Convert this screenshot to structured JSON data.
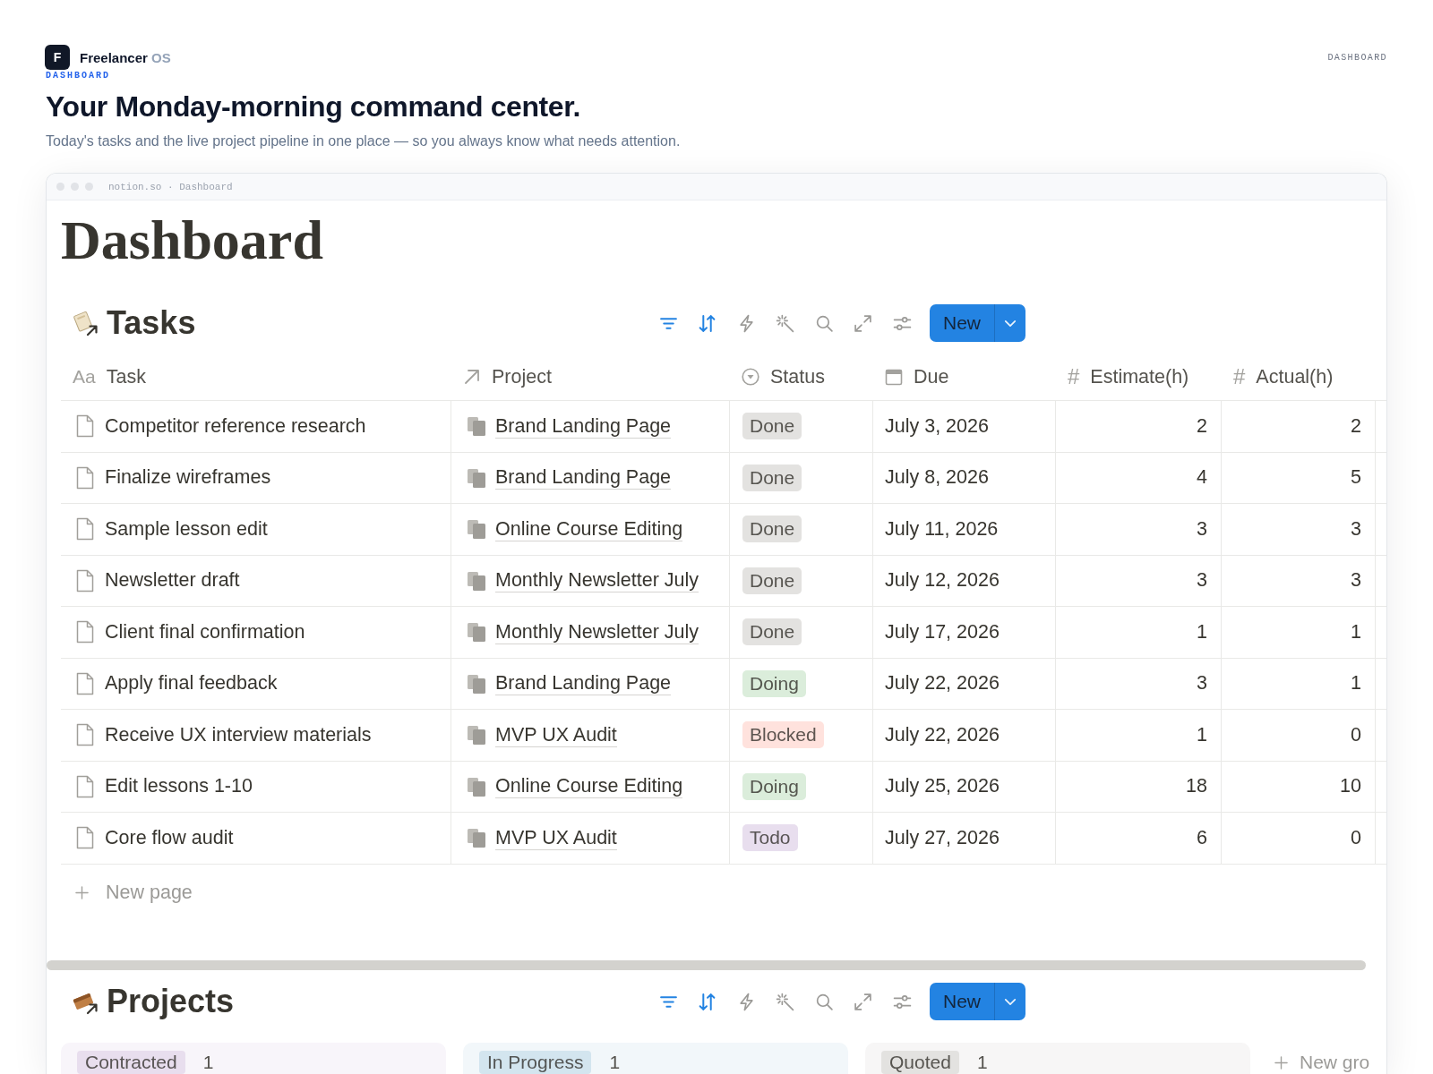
{
  "brand": {
    "logo_letter": "F",
    "name": "Freelancer",
    "suffix": "OS",
    "section": "DASHBOARD"
  },
  "nav_label": "DASHBOARD",
  "headline": "Your Monday-morning command center.",
  "subtitle": "Today's tasks and the live project pipeline in one place — so you always know what needs attention.",
  "browser": {
    "url": "notion.so · Dashboard"
  },
  "page_title": "Dashboard",
  "tasks": {
    "title": "Tasks",
    "tools": [
      {
        "kind": "filter",
        "active": true
      },
      {
        "kind": "sort",
        "active": true
      },
      {
        "kind": "automation",
        "active": false
      },
      {
        "kind": "ai",
        "active": false
      },
      {
        "kind": "search",
        "active": false
      },
      {
        "kind": "expand",
        "active": false
      },
      {
        "kind": "settings",
        "active": false
      }
    ],
    "new_button": "New",
    "columns": [
      {
        "kind": "title",
        "glyph": "Aa",
        "label": "Task"
      },
      {
        "kind": "relation",
        "label": "Project"
      },
      {
        "kind": "status",
        "label": "Status"
      },
      {
        "kind": "date",
        "label": "Due"
      },
      {
        "kind": "number",
        "glyph": "#",
        "label": "Estimate(h)"
      },
      {
        "kind": "number",
        "glyph": "#",
        "label": "Actual(h)"
      }
    ],
    "rows": [
      {
        "task": "Competitor reference research",
        "project": "Brand Landing Page",
        "status": {
          "label": "Done",
          "color": "#e3e2e0"
        },
        "due": "July 3, 2026",
        "estimate": "2",
        "actual": "2"
      },
      {
        "task": "Finalize wireframes",
        "project": "Brand Landing Page",
        "status": {
          "label": "Done",
          "color": "#e3e2e0"
        },
        "due": "July 8, 2026",
        "estimate": "4",
        "actual": "5"
      },
      {
        "task": "Sample lesson edit",
        "project": "Online Course Editing",
        "status": {
          "label": "Done",
          "color": "#e3e2e0"
        },
        "due": "July 11, 2026",
        "estimate": "3",
        "actual": "3"
      },
      {
        "task": "Newsletter draft",
        "project": "Monthly Newsletter July",
        "status": {
          "label": "Done",
          "color": "#e3e2e0"
        },
        "due": "July 12, 2026",
        "estimate": "3",
        "actual": "3"
      },
      {
        "task": "Client final confirmation",
        "project": "Monthly Newsletter July",
        "status": {
          "label": "Done",
          "color": "#e3e2e0"
        },
        "due": "July 17, 2026",
        "estimate": "1",
        "actual": "1"
      },
      {
        "task": "Apply final feedback",
        "project": "Brand Landing Page",
        "status": {
          "label": "Doing",
          "color": "#dbeddb"
        },
        "due": "July 22, 2026",
        "estimate": "3",
        "actual": "1"
      },
      {
        "task": "Receive UX interview materials",
        "project": "MVP UX Audit",
        "status": {
          "label": "Blocked",
          "color": "#ffe2dd"
        },
        "due": "July 22, 2026",
        "estimate": "1",
        "actual": "0"
      },
      {
        "task": "Edit lessons 1-10",
        "project": "Online Course Editing",
        "status": {
          "label": "Doing",
          "color": "#dbeddb"
        },
        "due": "July 25, 2026",
        "estimate": "18",
        "actual": "10"
      },
      {
        "task": "Core flow audit",
        "project": "MVP UX Audit",
        "status": {
          "label": "Todo",
          "color": "#e8deee"
        },
        "due": "July 27, 2026",
        "estimate": "6",
        "actual": "0"
      }
    ],
    "new_row": "New page"
  },
  "projects": {
    "title": "Projects",
    "tools": [
      {
        "kind": "filter",
        "active": true
      },
      {
        "kind": "sort",
        "active": true
      },
      {
        "kind": "automation",
        "active": false
      },
      {
        "kind": "ai",
        "active": false
      },
      {
        "kind": "search",
        "active": false
      },
      {
        "kind": "expand",
        "active": false
      },
      {
        "kind": "settings",
        "active": false
      }
    ],
    "new_button": "New",
    "groups": [
      {
        "label": "Contracted",
        "count": "1",
        "color": "#e8deee"
      },
      {
        "label": "In Progress",
        "count": "1",
        "color": "#d3e5ef"
      },
      {
        "label": "Quoted",
        "count": "1",
        "color": "#e3e2e0"
      }
    ],
    "new_group": "New gro"
  }
}
